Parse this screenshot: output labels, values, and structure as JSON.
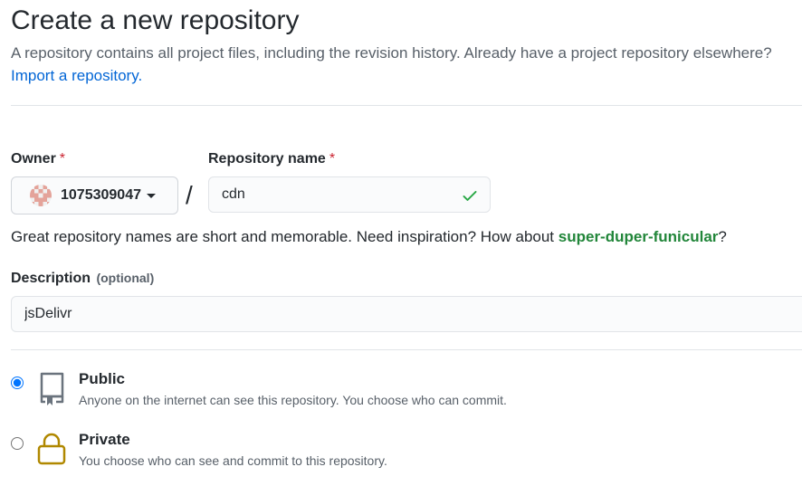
{
  "header": {
    "title": "Create a new repository",
    "subtitle": "A repository contains all project files, including the revision history. Already have a project repository elsewhere?",
    "import_link": "Import a repository."
  },
  "owner": {
    "label": "Owner",
    "required_mark": "*",
    "value": "1075309047"
  },
  "separator": "/",
  "repo_name": {
    "label": "Repository name",
    "required_mark": "*",
    "value": "cdn",
    "valid": true
  },
  "hint": {
    "text": "Great repository names are short and memorable. Need inspiration? How about ",
    "suggestion": "super-duper-funicular",
    "suffix": "?"
  },
  "description": {
    "label": "Description",
    "optional": "(optional)",
    "value": "jsDelivr"
  },
  "visibility": {
    "selected": "public",
    "options": [
      {
        "id": "public",
        "title": "Public",
        "description": "Anyone on the internet can see this repository. You choose who can commit.",
        "icon": "repo-icon"
      },
      {
        "id": "private",
        "title": "Private",
        "description": "You choose who can see and commit to this repository.",
        "icon": "lock-icon"
      }
    ]
  },
  "colors": {
    "link": "#0366d6",
    "success": "#28a745",
    "suggestion": "#22863a",
    "required": "#cb2431",
    "lock": "#b08800"
  }
}
